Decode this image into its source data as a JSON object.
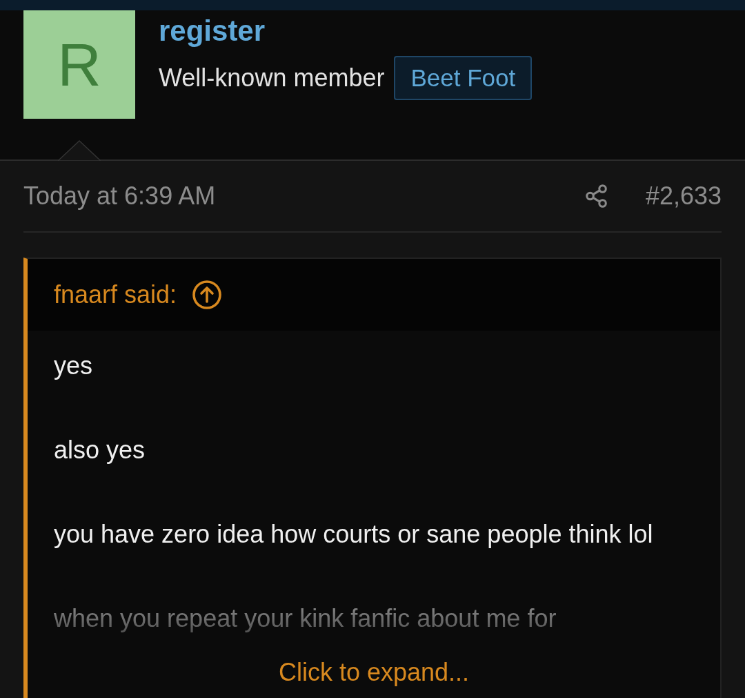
{
  "author": {
    "avatar_letter": "R",
    "name": "register",
    "title": "Well-known member",
    "badge": "Beet Foot"
  },
  "post": {
    "time": "Today at 6:39 AM",
    "number": "#2,633"
  },
  "quote": {
    "attribution": "fnaarf said:",
    "paragraphs": [
      "yes",
      "also yes",
      "you have zero idea how courts or sane people think lol",
      "when you repeat your kink fanfic about me for"
    ],
    "expand_link": "Click to expand..."
  }
}
